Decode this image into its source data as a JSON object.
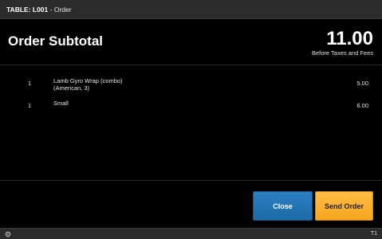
{
  "window": {
    "title_prefix": "TABLE: L001",
    "title_suffix": " - Order"
  },
  "header": {
    "heading": "Order Subtotal",
    "total": "11.00",
    "total_note": "Before Taxes and Fees"
  },
  "items": [
    {
      "qty": "1",
      "name_line1": "Lamb Gyro Wrap (combo)",
      "name_line2": "(American, 3)",
      "price": "5.00"
    },
    {
      "qty": "1",
      "name_line1": "Small",
      "name_line2": "",
      "price": "6.00"
    }
  ],
  "actions": {
    "close_label": "Close",
    "send_label": "Send Order"
  },
  "statusbar": {
    "icon": "settings-icon",
    "terminal": "T1"
  },
  "colors": {
    "background": "#000000",
    "bar": "#2b2b2b",
    "close_button": "#2374b5",
    "send_button": "#f8ac2a"
  }
}
